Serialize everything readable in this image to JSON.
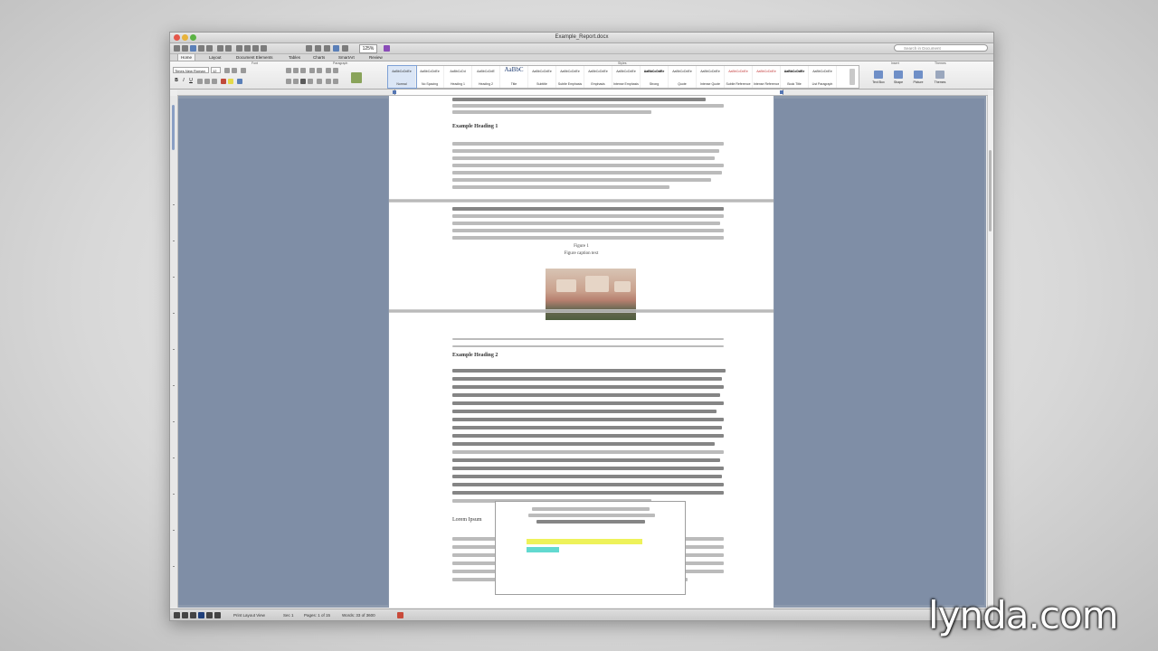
{
  "window": {
    "title": "Example_Report.docx"
  },
  "toolbar": {
    "zoom": "125%",
    "search_placeholder": "Search in Document"
  },
  "ribbon_tabs": [
    {
      "label": "Home"
    },
    {
      "label": "Layout"
    },
    {
      "label": "Document Elements"
    },
    {
      "label": "Tables"
    },
    {
      "label": "Charts"
    },
    {
      "label": "SmartArt"
    },
    {
      "label": "Review"
    }
  ],
  "ribbon_groups": {
    "font": "Font",
    "paragraph": "Paragraph",
    "styles": "Styles",
    "insert": "Insert",
    "themes": "Themes"
  },
  "font": {
    "name": "Times New Roman",
    "size": "12"
  },
  "format_buttons": [
    "B",
    "I",
    "U"
  ],
  "styles": [
    {
      "sample": "AaBbCcDdEe",
      "name": "Normal",
      "kind": "normal",
      "selected": true
    },
    {
      "sample": "AaBbCcDdEe",
      "name": "No Spacing",
      "kind": "normal"
    },
    {
      "sample": "AaBbCcDd",
      "name": "Heading 1",
      "kind": "normal"
    },
    {
      "sample": "AaBbCcDdE",
      "name": "Heading 2",
      "kind": "normal"
    },
    {
      "sample": "AaBbC",
      "name": "Title",
      "kind": "big"
    },
    {
      "sample": "AaBbCcDdEe",
      "name": "Subtitle",
      "kind": "normal"
    },
    {
      "sample": "AaBbCcDdEe",
      "name": "Subtle Emphasis",
      "kind": "normal"
    },
    {
      "sample": "AaBbCcDdEe",
      "name": "Emphasis",
      "kind": "normal"
    },
    {
      "sample": "AaBbCcDdEe",
      "name": "Intense Emphasis",
      "kind": "normal"
    },
    {
      "sample": "AaBbCcDdEe",
      "name": "Strong",
      "kind": "bold"
    },
    {
      "sample": "AaBbCcDdEe",
      "name": "Quote",
      "kind": "normal"
    },
    {
      "sample": "AaBbCcDdEe",
      "name": "Intense Quote",
      "kind": "normal"
    },
    {
      "sample": "AaBbCcDdEe",
      "name": "Subtle Reference",
      "kind": "red"
    },
    {
      "sample": "AaBbCcDdEe",
      "name": "Intense Reference",
      "kind": "red"
    },
    {
      "sample": "AaBbCcDdEe",
      "name": "Book Title",
      "kind": "bold"
    },
    {
      "sample": "AaBbCcDdEe",
      "name": "List Paragraph",
      "kind": "normal"
    }
  ],
  "insert_buttons": [
    {
      "label": "Text Box"
    },
    {
      "label": "Shape"
    },
    {
      "label": "Picture"
    },
    {
      "label": "Themes"
    }
  ],
  "document": {
    "heading_1": "Example Heading 1",
    "caption_line_1": "Figure 1",
    "caption_line_2": "Figure caption text",
    "heading_2": "Example Heading 2",
    "heading_3": "Lorem Ipsum"
  },
  "status": {
    "view": "Print Layout View",
    "sec": "Sec 1",
    "pages": "Pages: 1 of 15",
    "words": "Words: 33 of 3600"
  },
  "watermark": "lynda.com"
}
